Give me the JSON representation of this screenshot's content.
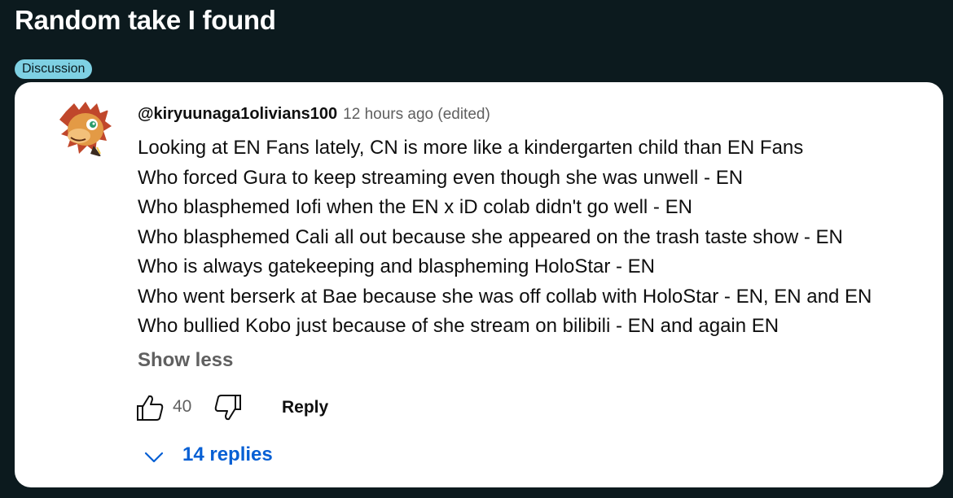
{
  "post": {
    "title": "Random take I found",
    "flair": "Discussion"
  },
  "comment": {
    "author": "@kiryuunaga1olivians100",
    "time": "12 hours ago (edited)",
    "lines": [
      "Looking at EN Fans lately, CN is more like a kindergarten child than EN Fans",
      "Who forced Gura to keep streaming even though she was unwell - EN",
      "Who blasphemed Iofi when the EN x iD colab didn't go well - EN",
      "Who blasphemed Cali all out because she appeared on the trash taste show - EN",
      "Who is always gatekeeping and blaspheming HoloStar - EN",
      "Who went berserk at Bae because she was off collab with HoloStar - EN, EN and EN",
      "Who bullied Kobo just because of she stream on bilibili - EN and again EN"
    ],
    "show_less": "Show less",
    "like_count": "40",
    "reply_label": "Reply",
    "replies_label": "14 replies"
  },
  "icons": {
    "avatar": "dragon-avatar-icon",
    "like": "thumbs-up-icon",
    "dislike": "thumbs-down-icon",
    "expand": "chevron-down-icon"
  },
  "colors": {
    "page_bg": "#0c1a1e",
    "flair_bg": "#7ed0e3",
    "card_bg": "#ffffff",
    "link_blue": "#065fd4",
    "secondary_text": "#606060"
  }
}
